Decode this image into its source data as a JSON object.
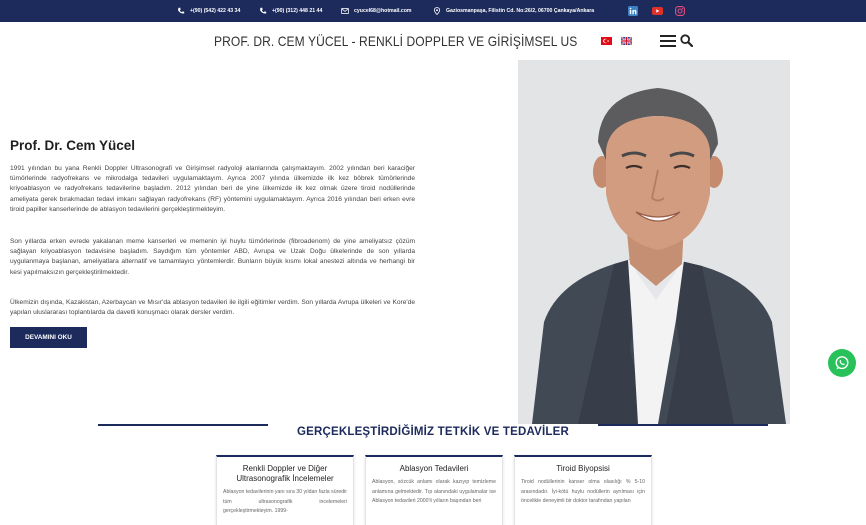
{
  "topbar": {
    "phone1": "+(90) (542) 422 43 34",
    "phone2": "+(90) (312) 448 21 44",
    "email": "cyucel68@hotmail.com",
    "address": "Gaziosmanpaşa, Filistin Cd. No:26/2, 06700 Çankaya/Ankara",
    "social": [
      "linkedin-icon",
      "youtube-icon",
      "instagram-icon"
    ]
  },
  "header": {
    "title": "PROF. DR. CEM YÜCEL - RENKLİ DOPPLER VE GİRİŞİMSEL US",
    "languages": [
      "Türkçe",
      "English"
    ]
  },
  "main": {
    "name": "Prof. Dr. Cem Yücel",
    "paragraphs": [
      "1991 yılından bu yana Renkli Doppler Ultrasonografi ve Girişimsel radyoloji alanlarında çalışmaktayım. 2002 yılından beri karaciğer tümörlerinde radyofrekans ve mikrodalga tedavileri uygulamaktayım. Ayrıca 2007 yılında ülkemizde ilk kez böbrek tümörlerinde kriyoablasyon ve radyofrekans tedavilerine başladım. 2012 yılından beri de yine ülkemizde ilk kez olmak üzere tiroid nodüllerinde ameliyata gerek bırakmadan tedavi imkanı sağlayan radyofrekans (RF) yöntemini uygulamaktayım. Ayrıca 2016 yılından beri erken evre tiroid papiller kanserlerinde de ablasyon tedavilerini gerçekleştirmekteyim.",
      "Son yıllarda erken evrede yakalanan meme kanserleri ve memenin iyi huylu tümörlerinde (fibroadenom) de yine ameliyatsız çözüm sağlayan kriyoablasyon tedavisine başladım. Saydığım tüm yöntemler ABD, Avrupa ve Uzak Doğu ülkelerinde de son yıllarda uygulanmaya başlanan, ameliyatlara alternatif ve tamamlayıcı yöntemlerdir. Bunların büyük kısmı lokal anestezi altında ve herhangi bir kesi yapılmaksızın gerçekleştirilmektedir.",
      "Ülkemizin dışında, Kazakistan, Azerbaycan ve Mısır'da ablasyon tedavileri ile ilgili eğitimler verdim. Son yıllarda Avrupa ülkeleri ve Kore'de yapılan uluslararası toplantılarda da davetli konuşmacı olarak dersler verdim."
    ],
    "more_button": "DEVAMINI OKU"
  },
  "section": {
    "title": "GERÇEKLEŞTİRDİĞİMİZ TETKİK VE TEDAVİLER",
    "cards": [
      {
        "title": "Renkli Doppler ve Diğer Ultrasonografik İncelemeler",
        "text": "Ablasyon tedavilerinin yanı sıra 30 yıldan fazla süredir tüm ultrasonografik incelemeleri gerçekleştirmekteyim. 1999-"
      },
      {
        "title": "Ablasyon Tedavileri",
        "text": "Ablasyon, sözcük anlamı olarak kazıyıp temizleme anlamına gelmektedir. Tıp alanındaki uygulamalar ise Ablasyon tedavileri 2000'li yılların başından beri"
      },
      {
        "title": "Tiroid Biyopsisi",
        "text": "Tiroid nodüllerinin kanser olma olasılığı % 5-10 arasındadır. İyi-kötü huylu nodüllerin ayrılması için öncelikle deneyimli bir doktor tarafından yapılan"
      }
    ]
  },
  "colors": {
    "navy": "#1c2a5c",
    "whatsapp": "#28c15a"
  }
}
